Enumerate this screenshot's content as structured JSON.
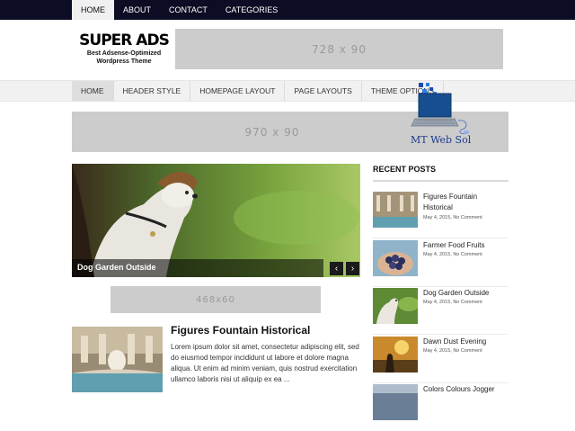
{
  "top_nav": [
    "HOME",
    "ABOUT",
    "CONTACT",
    "CATEGORIES"
  ],
  "logo": {
    "title": "SUPER ADS",
    "tagline_1": "Best Adsense-Optimized",
    "tagline_2": "Wordpress Theme"
  },
  "ads": {
    "header": "728 x 90",
    "wide": "970 x 90",
    "content": "468x60"
  },
  "main_menu": [
    "HOME",
    "HEADER STYLE",
    "HOMEPAGE LAYOUT",
    "PAGE LAYOUTS",
    "THEME OPTIONS"
  ],
  "watermark": "MT Web Sol",
  "slider": {
    "caption": "Dog Garden Outside",
    "prev_icon": "‹",
    "next_icon": "›"
  },
  "featured_post": {
    "title": "Figures Fountain Historical",
    "excerpt": "Lorem ipsum dolor sit amet, consectetur adipiscing elit, sed do eiusmod tempor incididunt ut labore et dolore magna aliqua. Ut enim ad minim veniam, quis nostrud exercitation ullamco laboris nisi ut aliquip ex ea ..."
  },
  "sidebar": {
    "heading": "RECENT POSTS",
    "posts": [
      {
        "title": "Figures Fountain Historical",
        "meta": "May 4, 2015, No Comment"
      },
      {
        "title": "Farmer Food Fruits",
        "meta": "May 4, 2015, No Comment"
      },
      {
        "title": "Dog Garden Outside",
        "meta": "May 4, 2015, No Comment"
      },
      {
        "title": "Dawn Dust Evening",
        "meta": "May 4, 2015, No Comment"
      },
      {
        "title": "Colors Colours Jogger",
        "meta": ""
      }
    ]
  },
  "colors": {
    "topbar": "#0c0c24",
    "ad_gray": "#cccccc",
    "menu_bg": "#f1f1f1"
  }
}
